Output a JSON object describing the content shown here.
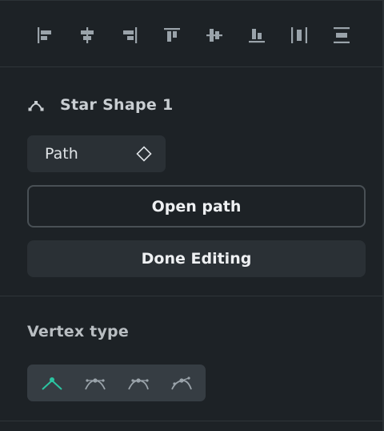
{
  "align_toolbar": {
    "buttons": [
      {
        "name": "align-left-icon"
      },
      {
        "name": "align-horizontal-center-icon"
      },
      {
        "name": "align-right-icon"
      },
      {
        "name": "align-top-icon"
      },
      {
        "name": "align-vertical-center-icon"
      },
      {
        "name": "align-bottom-icon"
      },
      {
        "name": "distribute-horizontal-icon"
      },
      {
        "name": "distribute-vertical-icon"
      }
    ]
  },
  "shape": {
    "title": "Star Shape 1",
    "icon": "path-node-icon"
  },
  "path_select": {
    "label": "Path",
    "icon": "diamond-icon"
  },
  "buttons": {
    "open_path": "Open path",
    "done_editing": "Done Editing"
  },
  "vertex": {
    "label": "Vertex type",
    "options": [
      {
        "name": "vertex-straight-icon",
        "selected": true
      },
      {
        "name": "vertex-mirrored-icon",
        "selected": false
      },
      {
        "name": "vertex-asymmetric-icon",
        "selected": false
      },
      {
        "name": "vertex-disconnected-icon",
        "selected": false
      }
    ]
  },
  "colors": {
    "background": "#1d2226",
    "control": "#2a3035",
    "accent": "#2bc4a1",
    "icon": "#9aa3aa"
  }
}
